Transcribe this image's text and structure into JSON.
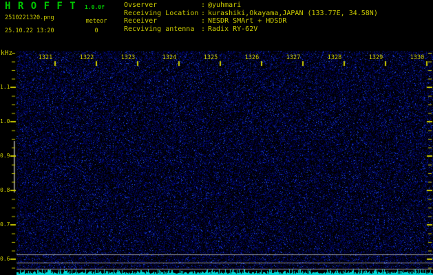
{
  "header": {
    "title": "H R O F F T",
    "version": "1.0.0f",
    "filename": "2510221320.png",
    "datetime": "25.10.22 13:20",
    "meteor_label": "meteor",
    "meteor_count": "0",
    "separator": ":",
    "info": [
      {
        "label": "Ovserver",
        "value": "@yuhmari"
      },
      {
        "label": "Receiving Location",
        "value": "kurashiki,Okayama,JAPAN (133.77E, 34.58N)"
      },
      {
        "label": "Receiver",
        "value": "NESDR SMArt + HDSDR"
      },
      {
        "label": "Recviving antenna",
        "value": "Radix RY-62V"
      }
    ]
  },
  "chart": {
    "unit": "kHz",
    "freq_ticks": [
      "1.1",
      "1.0",
      "0.9",
      "0.8",
      "0.7",
      "0.6"
    ],
    "time_ticks": [
      "1321",
      "1322",
      "1323",
      "1324",
      "1325",
      "1326",
      "1327",
      "1328",
      "1329",
      "1330"
    ],
    "description": "spectrogram noise background with no meteor echoes; band marker lines near 0.6 kHz; cyan signal-level trace along bottom"
  },
  "colors": {
    "text_yellow": "#cccc00",
    "title_green": "#00c800",
    "noise_blue": "#0000cc",
    "trace_cyan": "#00d8d8",
    "line_gray": "#9a9a9a",
    "bar_gray": "#b0b0b0"
  }
}
